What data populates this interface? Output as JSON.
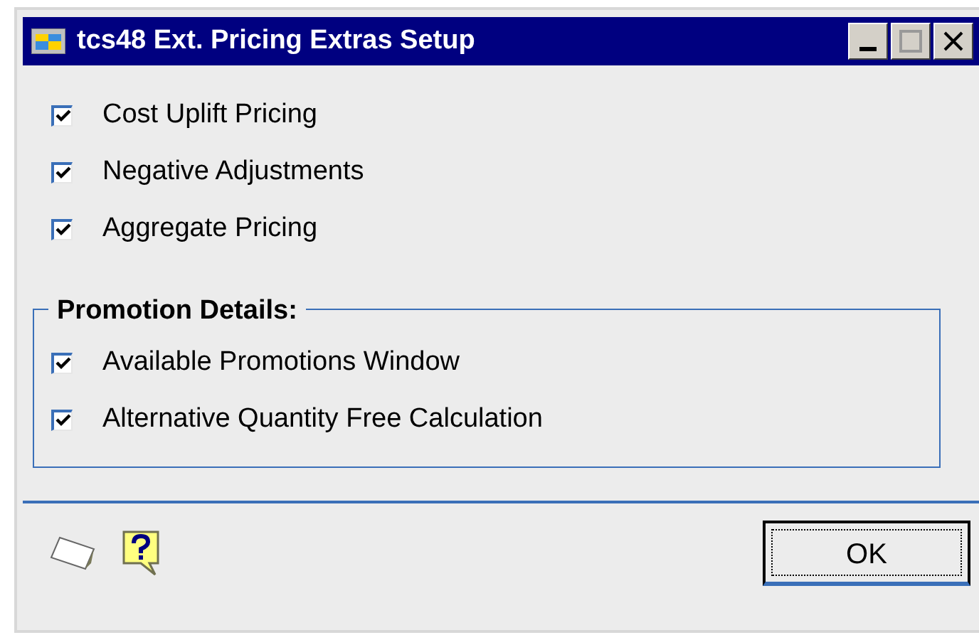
{
  "window": {
    "title": "tcs48 Ext. Pricing Extras Setup"
  },
  "options": [
    {
      "label": "Cost Uplift Pricing",
      "checked": true
    },
    {
      "label": "Negative Adjustments",
      "checked": true
    },
    {
      "label": "Aggregate Pricing",
      "checked": true
    }
  ],
  "promotion_details": {
    "title": "Promotion Details:",
    "options": [
      {
        "label": "Available Promotions Window",
        "checked": true
      },
      {
        "label": "Alternative Quantity Free Calculation",
        "checked": true
      }
    ]
  },
  "buttons": {
    "ok": "OK"
  }
}
